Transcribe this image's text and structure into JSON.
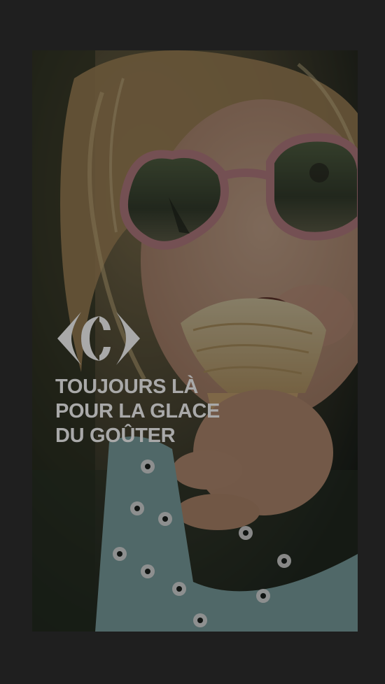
{
  "ad": {
    "brand": "Carrefour",
    "headline_lines": [
      "TOUJOURS LÀ",
      "POUR LA GLACE",
      "DU GOÛTER"
    ],
    "photo_subject": "child-eating-ice-cream-with-heart-sunglasses"
  },
  "colors": {
    "page_background": "#1f1f1f",
    "headline_text": "#a9a9a9",
    "logo": "#a9a9a9",
    "sunglasses_frame": "#c98a8f",
    "dress": "#8ab3b3"
  },
  "icons": {
    "logo": "carrefour-logo-icon"
  }
}
